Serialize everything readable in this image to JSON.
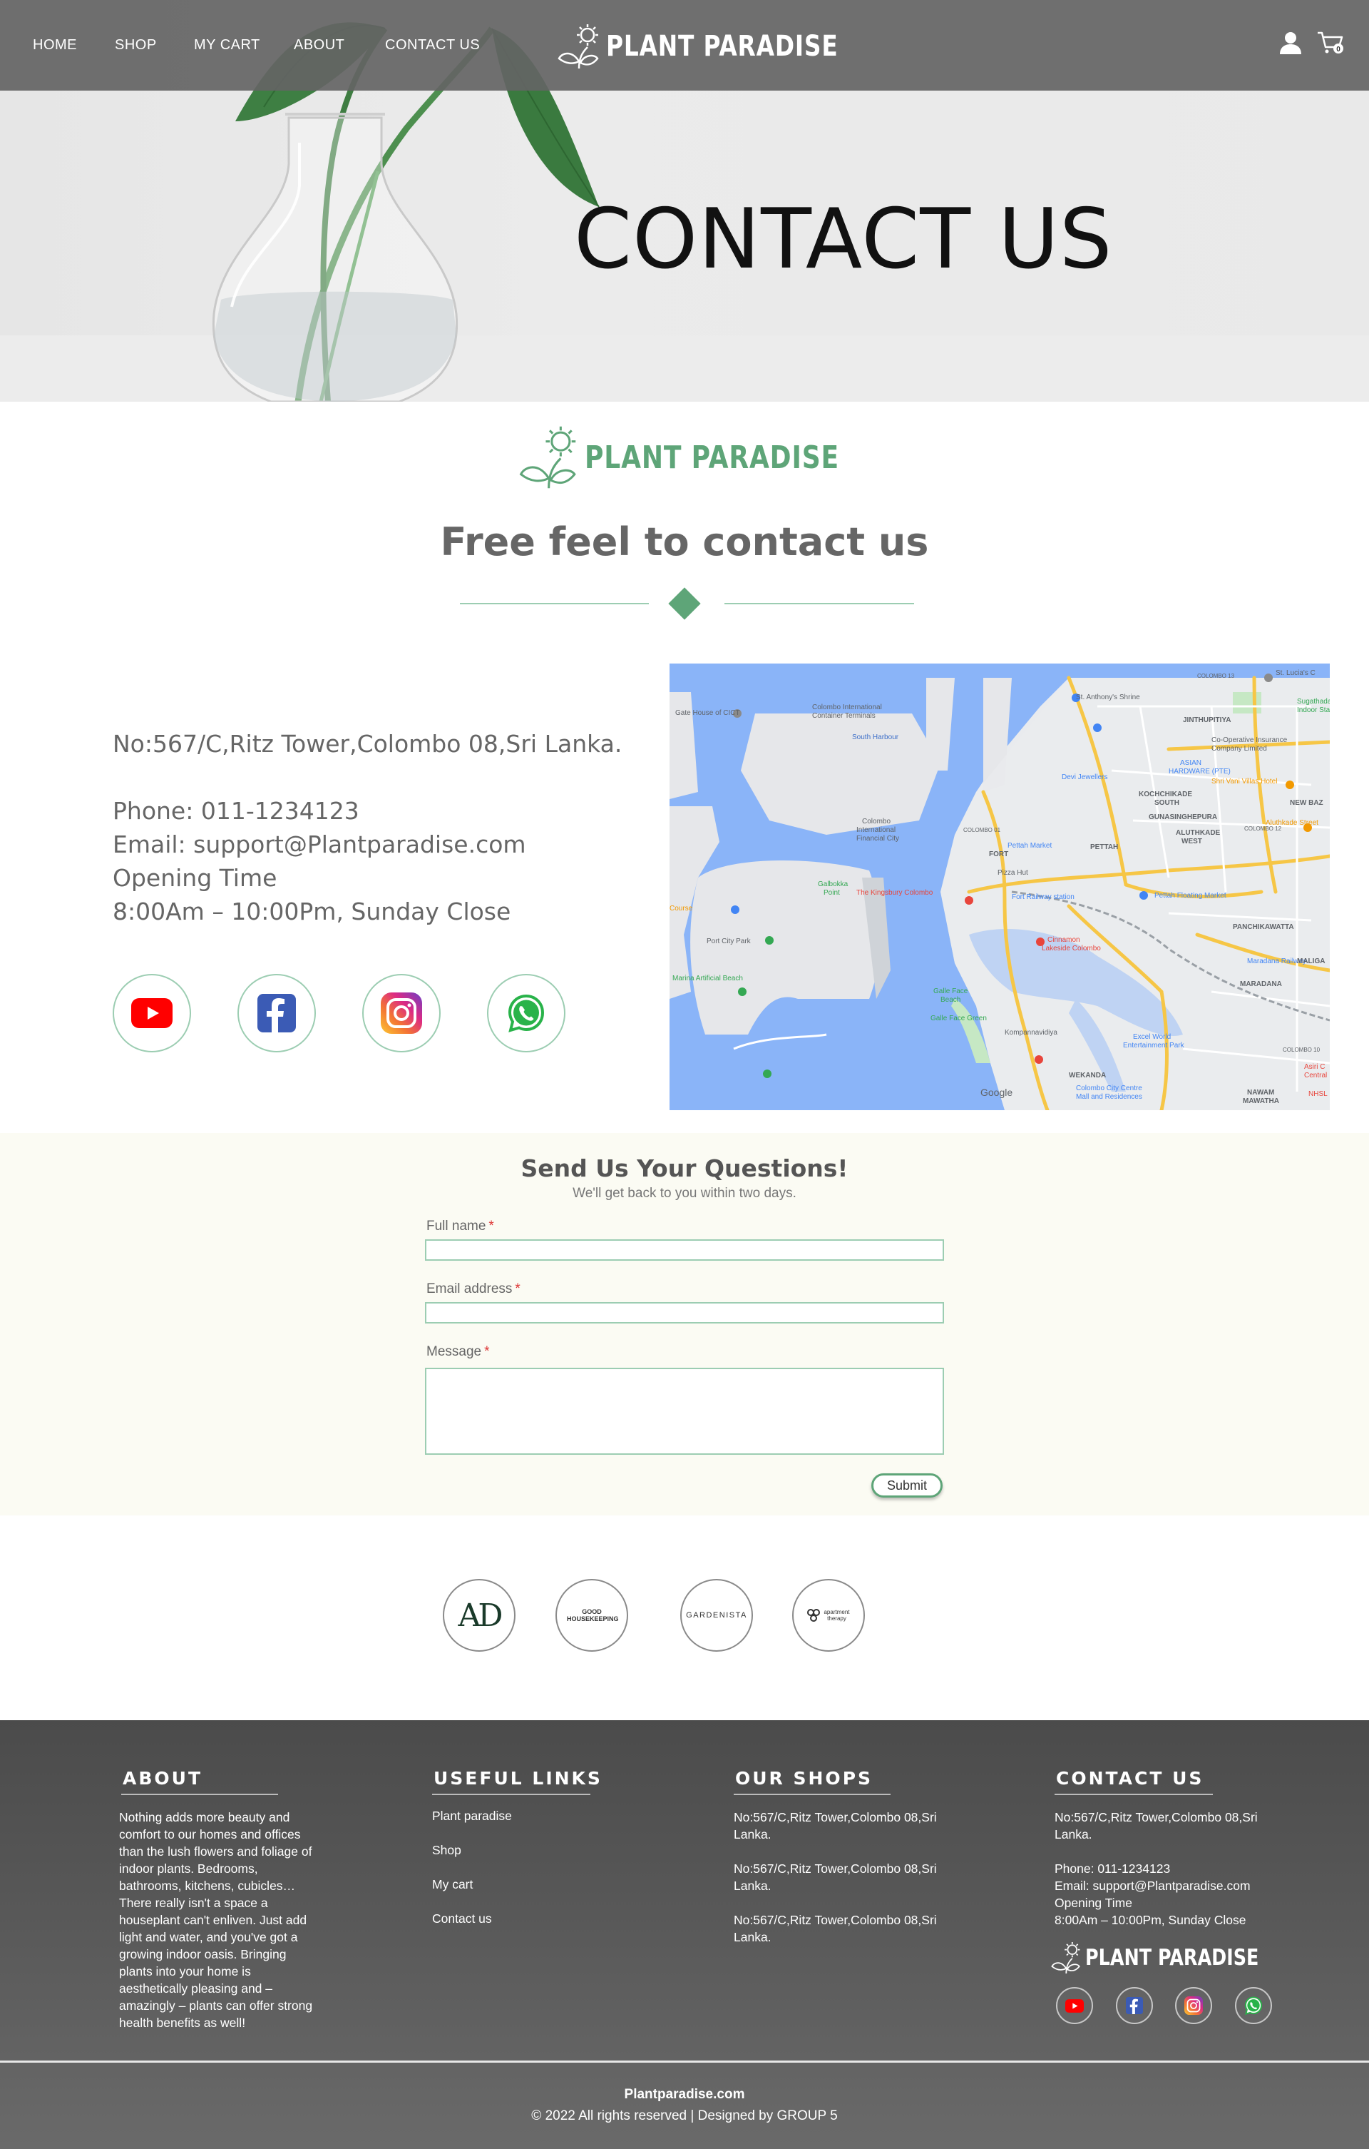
{
  "nav": {
    "items": [
      "HOME",
      "SHOP",
      "MY CART",
      "ABOUT",
      "CONTACT US"
    ],
    "brand": "PLANT PARADISE",
    "icons": [
      "user-icon",
      "cart-icon"
    ],
    "cart_count": "0"
  },
  "hero": {
    "title": "CONTACT US"
  },
  "intro": {
    "logo_text": "PLANT PARADISE",
    "title": "Free feel to contact us"
  },
  "contact": {
    "address": "No:567/C,Ritz Tower,Colombo 08,Sri Lanka.",
    "phone": "Phone: 011-1234123",
    "email": "Email: support@Plantparadise.com",
    "opening_label": "Opening Time",
    "opening_hours": "8:00Am – 10:00Pm, Sunday Close",
    "social": [
      "youtube-icon",
      "facebook-icon",
      "instagram-icon",
      "whatsapp-icon"
    ]
  },
  "map": {
    "labels": [
      "Gate House of CICT",
      "Colombo International Container Terminals",
      "South Harbour",
      "St. Anthony's Shrine",
      "JINTHUPITIYA",
      "Co-Operative Insurance Company Limited",
      "ASIAN HARDWARE (PTE)",
      "Shri Vani Villas Hotel",
      "Devi Jewellers",
      "KOCHCHIKADE SOUTH",
      "NEW BAZ",
      "GUNASINGHEPURA",
      "Aluthkade Street",
      "ALUTHKADE WEST",
      "Colombo International Financial City",
      "COLOMBO 01",
      "FORT",
      "Pettah Market",
      "PETTAH",
      "Pizza Hut",
      "Galbokka Point",
      "The Kingsbury Colombo",
      "Fort Railway station",
      "Pettah Floating Market",
      "PANCHIKAWATTA",
      "Port City Park",
      "Cinnamon Lakeside Colombo",
      "Maradana Railway",
      "MARADANA",
      "Marina Artificial Beach",
      "Galle Face Beach",
      "Galle Face Green",
      "Kompannavidiya",
      "Excel World Entertainment Park",
      "WEKANDA",
      "Colombo City Centre Mall and Residences",
      "Google",
      "NAWAM MAWATHA",
      "Sugathadasa Indoor Stadium",
      "St. Lucia's C",
      "COLOMBO 13",
      "COLOMBO 12",
      "COLOMBO 10",
      "MALIGA",
      "Asiri C Central",
      "NHSL",
      "Course"
    ]
  },
  "form": {
    "title": "Send Us Your Questions!",
    "subtitle": "We'll get back to you within two days.",
    "fields": [
      {
        "label": "Full name",
        "required": "*",
        "value": ""
      },
      {
        "label": "Email address",
        "required": "*",
        "value": ""
      },
      {
        "label": "Message",
        "required": "*",
        "value": ""
      }
    ],
    "submit": "Submit"
  },
  "partners": [
    "AD",
    "GOOD HOUSEKEEPING",
    "GARDENISTA",
    "apartment therapy"
  ],
  "footer": {
    "about": {
      "heading": "ABOUT",
      "lines": [
        "Nothing adds more beauty and",
        "comfort to our homes and offices",
        "than the lush flowers and foliage of",
        "indoor plants. Bedrooms,",
        "bathrooms, kitchens, cubicles…",
        "There really isn't a space a",
        "houseplant can't enliven. Just add",
        "light and water, and you've got a",
        "growing indoor oasis. Bringing",
        "plants into your home is",
        "aesthetically pleasing and –",
        "amazingly – plants can offer strong",
        "health benefits as well!"
      ]
    },
    "links": {
      "heading": "USEFUL LINKS",
      "items": [
        "Plant paradise",
        "Shop",
        "My cart",
        "Contact us"
      ]
    },
    "shops": {
      "heading": "OUR SHOPS",
      "items": [
        [
          "No:567/C,Ritz Tower,Colombo 08,Sri",
          "Lanka."
        ],
        [
          "No:567/C,Ritz Tower,Colombo 08,Sri",
          "Lanka."
        ],
        [
          "No:567/C,Ritz Tower,Colombo 08,Sri",
          "Lanka."
        ]
      ]
    },
    "contact": {
      "heading": "CONTACT US",
      "address": [
        "No:567/C,Ritz Tower,Colombo 08,Sri",
        "Lanka."
      ],
      "phone": "Phone: 011-1234123",
      "email": "Email: support@Plantparadise.com",
      "opening_label": "Opening Time",
      "opening_hours": "8:00Am – 10:00Pm, Sunday Close",
      "logo_text": "PLANT PARADISE"
    },
    "site": "Plantparadise.com",
    "copyright": "© 2022 All rights reserved | Designed by GROUP 5"
  },
  "colors": {
    "brand_green": "#5ea578",
    "accent_light_green": "#9ccdb2",
    "nav_bg": "#646464",
    "footer_bg": "#555555",
    "form_bg": "#fbfbf3"
  }
}
